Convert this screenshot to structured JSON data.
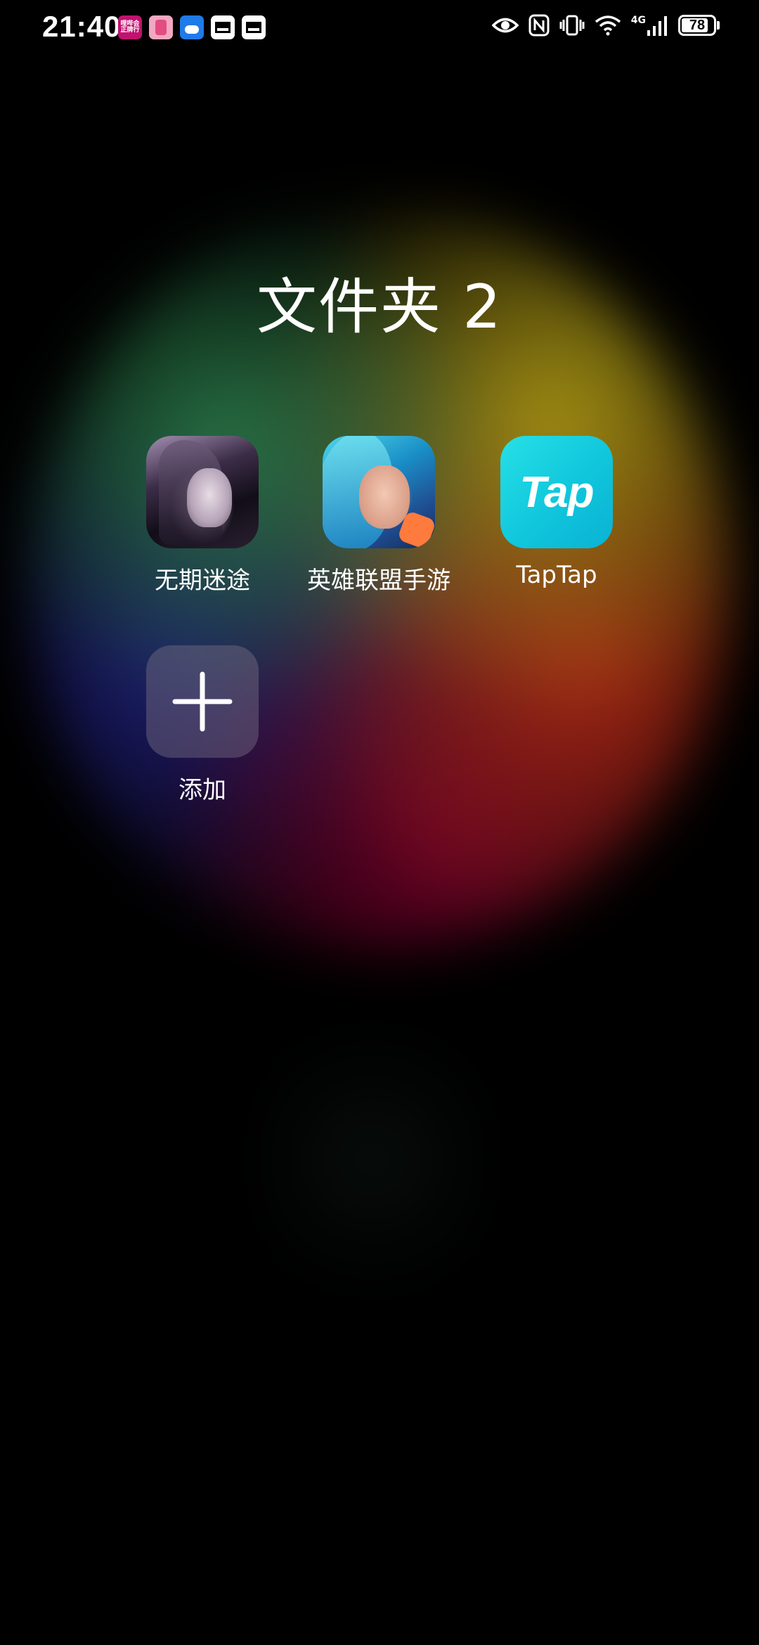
{
  "status_bar": {
    "time": "21:40",
    "notification_icons": [
      "app-notification-icon",
      "app-notification-icon",
      "weather-icon",
      "message-icon",
      "message-icon"
    ],
    "notif1_text": "哩哔会\n正牌行",
    "system_icons": [
      "eye-comfort-icon",
      "nfc-icon",
      "vibrate-icon",
      "wifi-icon",
      "signal-4g-icon",
      "signal-bars-icon",
      "battery-icon"
    ],
    "network_label": "4G",
    "battery_level": "78"
  },
  "folder": {
    "title": "文件夹 2",
    "apps": [
      {
        "label": "无期迷途",
        "icon": "wuqi-mitu-app-icon"
      },
      {
        "label": "英雄联盟手游",
        "icon": "league-of-legends-app-icon"
      },
      {
        "label": "TapTap",
        "icon": "taptap-app-icon",
        "icon_text": "Tap"
      },
      {
        "label": "添加",
        "icon": "plus-icon"
      }
    ]
  },
  "colors": {
    "background": "#000000",
    "taptap_brand": "#15c8dd",
    "add_tile": "#5a5262"
  }
}
